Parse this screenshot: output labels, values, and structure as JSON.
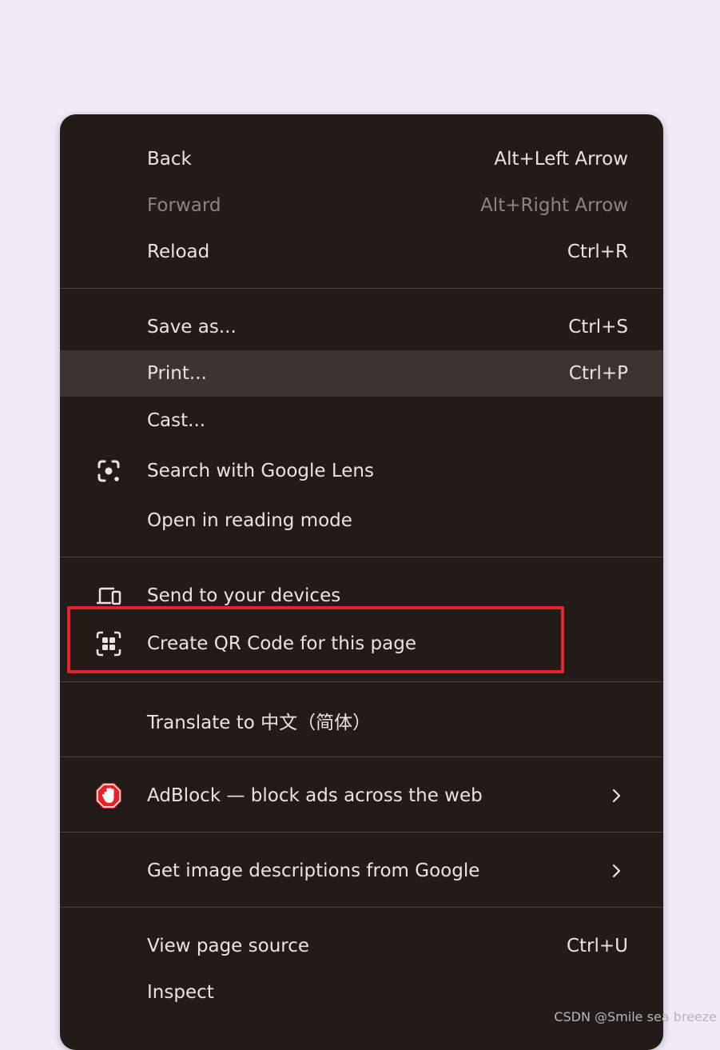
{
  "menu": {
    "back": {
      "label": "Back",
      "shortcut": "Alt+Left Arrow"
    },
    "forward": {
      "label": "Forward",
      "shortcut": "Alt+Right Arrow"
    },
    "reload": {
      "label": "Reload",
      "shortcut": "Ctrl+R"
    },
    "save_as": {
      "label": "Save as...",
      "shortcut": "Ctrl+S"
    },
    "print": {
      "label": "Print...",
      "shortcut": "Ctrl+P"
    },
    "cast": {
      "label": "Cast..."
    },
    "google_lens": {
      "label": "Search with Google Lens",
      "icon": "google-lens-icon"
    },
    "reading_mode": {
      "label": "Open in reading mode"
    },
    "send_to_devices": {
      "label": "Send to your devices",
      "icon": "devices-icon"
    },
    "qr_code": {
      "label": "Create QR Code for this page",
      "icon": "qr-code-icon"
    },
    "translate": {
      "label": "Translate to 中文（简体）"
    },
    "adblock": {
      "label": "AdBlock — block ads across the web",
      "icon": "adblock-icon"
    },
    "image_descriptions": {
      "label": "Get image descriptions from Google"
    },
    "view_source": {
      "label": "View page source",
      "shortcut": "Ctrl+U"
    },
    "inspect": {
      "label": "Inspect"
    }
  },
  "watermark": "CSDN @Smile sea breeze",
  "colors": {
    "menu_background": "#221b18",
    "menu_text": "#ede2dd",
    "disabled_text": "#8b8480",
    "hover_background": "#3b3430",
    "annotation_box": "#e3262f",
    "adblock_red": "#e8202a"
  }
}
